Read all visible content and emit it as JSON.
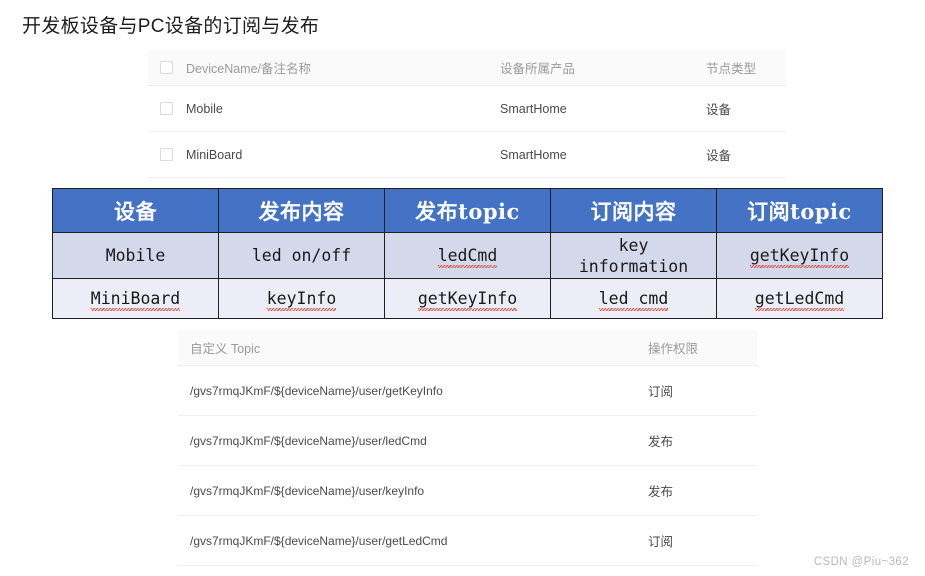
{
  "page": {
    "title": "开发板设备与PC设备的订阅与发布",
    "watermark": "CSDN @Piu~362",
    "accent_blue": "#4472C4",
    "row_a_fill": "#D3D8EB",
    "row_b_fill": "#ECEDF6"
  },
  "device_table": {
    "headers": {
      "name": "DeviceName/备注名称",
      "product": "设备所属产品",
      "node_type": "节点类型"
    },
    "rows": [
      {
        "name": "Mobile",
        "product": "SmartHome",
        "node_type": "设备"
      },
      {
        "name": "MiniBoard",
        "product": "SmartHome",
        "node_type": "设备"
      }
    ]
  },
  "mapping_table": {
    "headers": [
      "设备",
      "发布内容",
      "发布topic",
      "订阅内容",
      "订阅topic"
    ],
    "rows": [
      {
        "device": "Mobile",
        "publish_content": "led on/off",
        "publish_topic": "ledCmd",
        "subscribe_content_line1": "key",
        "subscribe_content_line2": "information",
        "subscribe_topic": "getKeyInfo"
      },
      {
        "device": "MiniBoard",
        "publish_content": "keyInfo",
        "publish_topic": "getKeyInfo",
        "subscribe_content": "led cmd",
        "subscribe_topic": "getLedCmd"
      }
    ]
  },
  "topic_table": {
    "headers": {
      "topic": "自定义 Topic",
      "permission": "操作权限"
    },
    "rows": [
      {
        "topic": "/gvs7rmqJKmF/${deviceName}/user/getKeyInfo",
        "permission": "订阅"
      },
      {
        "topic": "/gvs7rmqJKmF/${deviceName}/user/ledCmd",
        "permission": "发布"
      },
      {
        "topic": "/gvs7rmqJKmF/${deviceName}/user/keyInfo",
        "permission": "发布"
      },
      {
        "topic": "/gvs7rmqJKmF/${deviceName}/user/getLedCmd",
        "permission": "订阅"
      }
    ]
  }
}
